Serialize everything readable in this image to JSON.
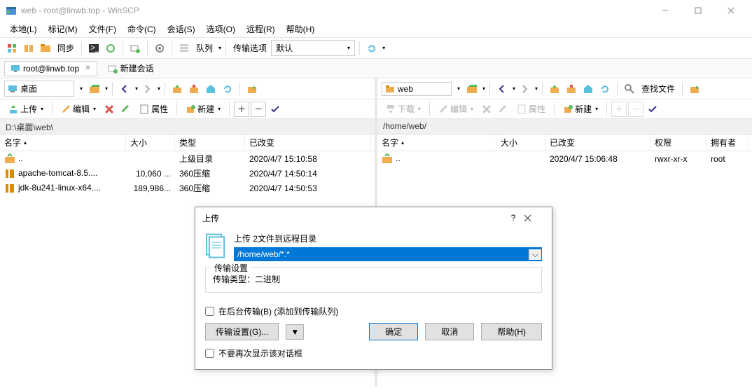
{
  "window": {
    "title": "web - root@linwb.top - WinSCP"
  },
  "menu": [
    "本地(L)",
    "标记(M)",
    "文件(F)",
    "命令(C)",
    "会话(S)",
    "选项(O)",
    "远程(R)",
    "帮助(H)"
  ],
  "toolbar": {
    "sync_label": "同步",
    "queue_label": "队列",
    "transfer_label": "传输选项",
    "transfer_value": "默认"
  },
  "tabs": {
    "session": "root@linwb.top",
    "new_session": "新建会话"
  },
  "left": {
    "drive": "桌面",
    "actions": {
      "upload": "上传",
      "edit": "编辑",
      "props": "属性",
      "new": "新建"
    },
    "path": "D:\\桌面\\web\\",
    "cols": [
      "名字",
      "大小",
      "类型",
      "已改变"
    ],
    "rows": [
      {
        "name": "..",
        "size": "",
        "type": "上级目录",
        "changed": "2020/4/7  15:10:58",
        "icon": "up"
      },
      {
        "name": "apache-tomcat-8.5....",
        "size": "10,060 ...",
        "type": "360压缩",
        "changed": "2020/4/7  14:50:14",
        "icon": "zip"
      },
      {
        "name": "jdk-8u241-linux-x64....",
        "size": "189,986...",
        "type": "360压缩",
        "changed": "2020/4/7  14:50:53",
        "icon": "zip"
      }
    ]
  },
  "right": {
    "drive": "web",
    "actions": {
      "download": "下载",
      "edit": "编辑",
      "props": "属性",
      "new": "新建",
      "find": "查找文件"
    },
    "path": "/home/web/",
    "cols": [
      "名字",
      "大小",
      "已改变",
      "权限",
      "拥有者"
    ],
    "rows": [
      {
        "name": "..",
        "size": "",
        "changed": "2020/4/7 15:06:48",
        "perm": "rwxr-xr-x",
        "owner": "root",
        "icon": "up"
      }
    ]
  },
  "dialog": {
    "title": "上传",
    "help_q": "?",
    "heading": "上传 2文件到远程目录",
    "path": "/home/web/*.*",
    "group_title": "传输设置",
    "group_text": "传输类型：二进制",
    "bg_checkbox": "在后台传输(B) (添加到传输队列)",
    "settings_btn": "传输设置(G)...",
    "ok": "确定",
    "cancel": "取消",
    "help": "帮助(H)",
    "noshow": "不要再次显示该对话框"
  }
}
